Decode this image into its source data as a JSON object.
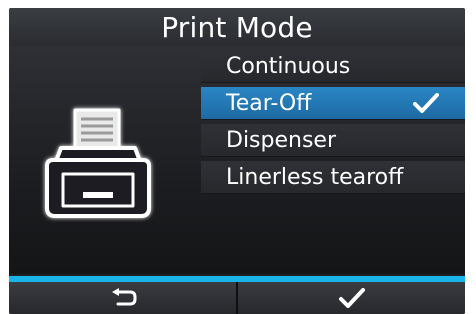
{
  "title": "Print Mode",
  "menu": {
    "items": [
      {
        "label": "Continuous",
        "selected": false,
        "checked": false
      },
      {
        "label": "Tear-Off",
        "selected": true,
        "checked": true
      },
      {
        "label": "Dispenser",
        "selected": false,
        "checked": false
      },
      {
        "label": "Linerless tearoff",
        "selected": false,
        "checked": false
      }
    ]
  },
  "softkeys": {
    "left_icon": "return-arrow-icon",
    "right_icon": "check-icon"
  },
  "colors": {
    "accent": "#19b4e8",
    "selected_row": "#2a86c4",
    "screen_bg": "#1d1f22",
    "text": "#ffffff"
  },
  "icons": {
    "illustration": "printer-icon",
    "selected_marker": "check-icon"
  }
}
